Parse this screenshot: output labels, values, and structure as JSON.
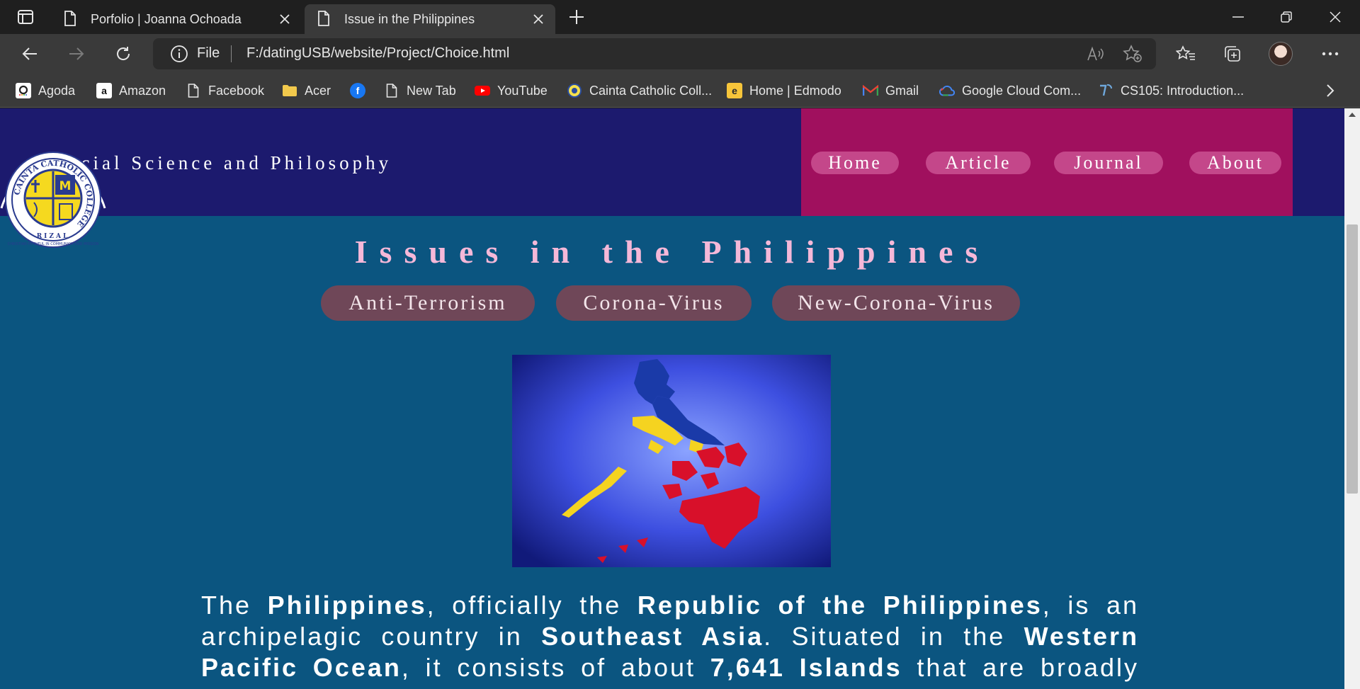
{
  "browser": {
    "tabs": [
      {
        "title": "Porfolio | Joanna Ochoada",
        "active": false
      },
      {
        "title": "Issue in the Philippines",
        "active": true
      }
    ],
    "address": {
      "scheme_label": "File",
      "url": "F:/datingUSB/website/Project/Choice.html"
    },
    "bookmarks": [
      {
        "label": "Agoda",
        "icon": "agoda-icon"
      },
      {
        "label": "Amazon",
        "icon": "amazon-icon"
      },
      {
        "label": "Facebook",
        "icon": "page-icon"
      },
      {
        "label": "Acer",
        "icon": "folder-icon"
      },
      {
        "label": "",
        "icon": "facebook-icon"
      },
      {
        "label": "New Tab",
        "icon": "page-icon"
      },
      {
        "label": "YouTube",
        "icon": "youtube-icon"
      },
      {
        "label": "Cainta Catholic Coll...",
        "icon": "school-icon"
      },
      {
        "label": "Home | Edmodo",
        "icon": "edmodo-icon"
      },
      {
        "label": "Gmail",
        "icon": "gmail-icon"
      },
      {
        "label": "Google Cloud Com...",
        "icon": "google-cloud-icon"
      },
      {
        "label": "CS105: Introduction...",
        "icon": "course-icon"
      }
    ]
  },
  "site": {
    "title": "ocial Science and Philosophy",
    "logo": {
      "ring_text": "CAINTA CATHOLIC COLLEGE",
      "location": "RIZAL",
      "motto": "CHRISTIAN FAITHFUL IN COMMUNION AND MISSION"
    },
    "nav": [
      "Home",
      "Article",
      "Journal",
      "About"
    ],
    "heading": "Issues in the Philippines",
    "topics": [
      "Anti-Terrorism",
      "Corona-Virus",
      "New-Corona-Virus"
    ],
    "paragraph": {
      "p1": "The ",
      "b1": "Philippines",
      "p2": ", officially the ",
      "b2": "Republic of the Philippines",
      "p3": ", is an archipelagic country in ",
      "b3": "Southeast Asia",
      "p4": ". Situated in the ",
      "b4": "Western Pacific Ocean",
      "p5": ", it consists of about ",
      "b5": "7,641 Islands",
      "p6": " that are broadly categorized"
    }
  },
  "colors": {
    "header_bg": "#1c1a6e",
    "nav_bg": "#a0105e",
    "nav_pill": "#c4478a",
    "page_bg": "#0b5580",
    "heading": "#f5b8d8",
    "topic_pill": "#6f4758"
  }
}
